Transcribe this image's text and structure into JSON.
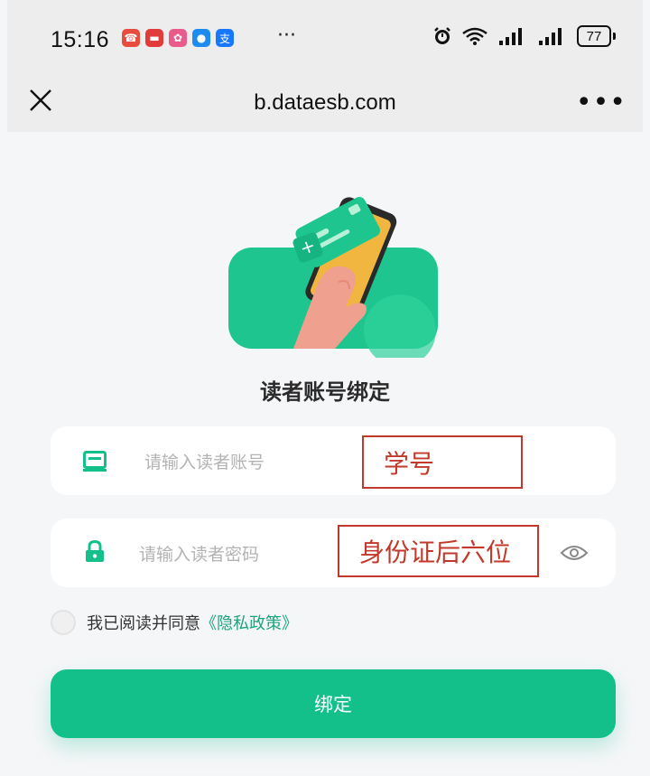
{
  "status": {
    "time": "15:16",
    "more": "···",
    "battery": "77"
  },
  "nav": {
    "title": "b.dataesb.com",
    "more": "•••"
  },
  "page": {
    "heading": "读者账号绑定",
    "account_placeholder": "请输入读者账号",
    "password_placeholder": "请输入读者密码",
    "account_annotation": "学号",
    "password_annotation": "身份证后六位",
    "agree_text": "我已阅读并同意",
    "privacy_link": "《隐私政策》",
    "bind_button": "绑定"
  },
  "colors": {
    "accent": "#13c08a",
    "link": "#1aa57a",
    "annotation": "#c0392b"
  },
  "icons": {
    "close": "close-icon",
    "card": "id-card-icon",
    "lock": "lock-icon",
    "eye": "eye-icon"
  }
}
